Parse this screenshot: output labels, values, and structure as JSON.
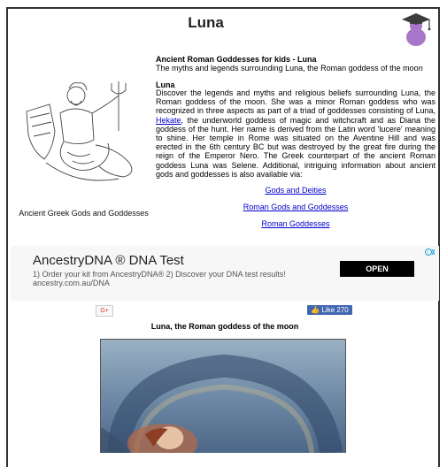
{
  "page": {
    "title": "Luna",
    "intro_heading": "Ancient Roman Goddesses for kids - Luna",
    "intro_subheading": "The myths and legends surrounding Luna, the Roman goddess of the moon",
    "section_heading": "Luna",
    "body_before_link": "Discover the legends and myths and religious beliefs surrounding Luna, the Roman goddess of the moon. She was a minor Roman goddess who was recognized in three aspects as part of a triad of goddesses consisting of Luna, ",
    "body_link": "Hekate",
    "body_after_link": ", the underworld goddess of magic and witchcraft and as Diana the goddess of the hunt. Her name is derived from the Latin word 'lucere' meaning to shine. Her temple in Rome was situated on the Aventine Hill and was erected in the 6th century BC but was destroyed by the great fire during the reign of the Emperor Nero. The Greek counterpart of the ancient Roman goddess Luna was Selene. Additional, intriguing information about ancient gods and goddesses is also available via:",
    "figure_caption": "Ancient Greek Gods and Goddesses",
    "links": [
      "Gods and Deities",
      "Roman Gods and Goddesses",
      "Roman Goddesses"
    ],
    "picture_caption": "Luna, the Roman goddess of the moon"
  },
  "ad": {
    "title": "AncestryDNA ® DNA Test",
    "line1": "1) Order your kit from AncestryDNA® 2) Discover your DNA test results!",
    "line2": "ancestry.com.au/DNA",
    "button": "OPEN"
  },
  "social": {
    "gplus_label": "G+",
    "like_label": "👍 Like 270"
  },
  "icons": {
    "header": "graduation-cap-icon",
    "figure": "neptune-figure-icon",
    "ad_badge": "ad-choices-icon"
  },
  "colors": {
    "link": "#0000cc",
    "like_button": "#4267b2",
    "ad_button": "#000000",
    "grad_icon": "#a877c9"
  }
}
